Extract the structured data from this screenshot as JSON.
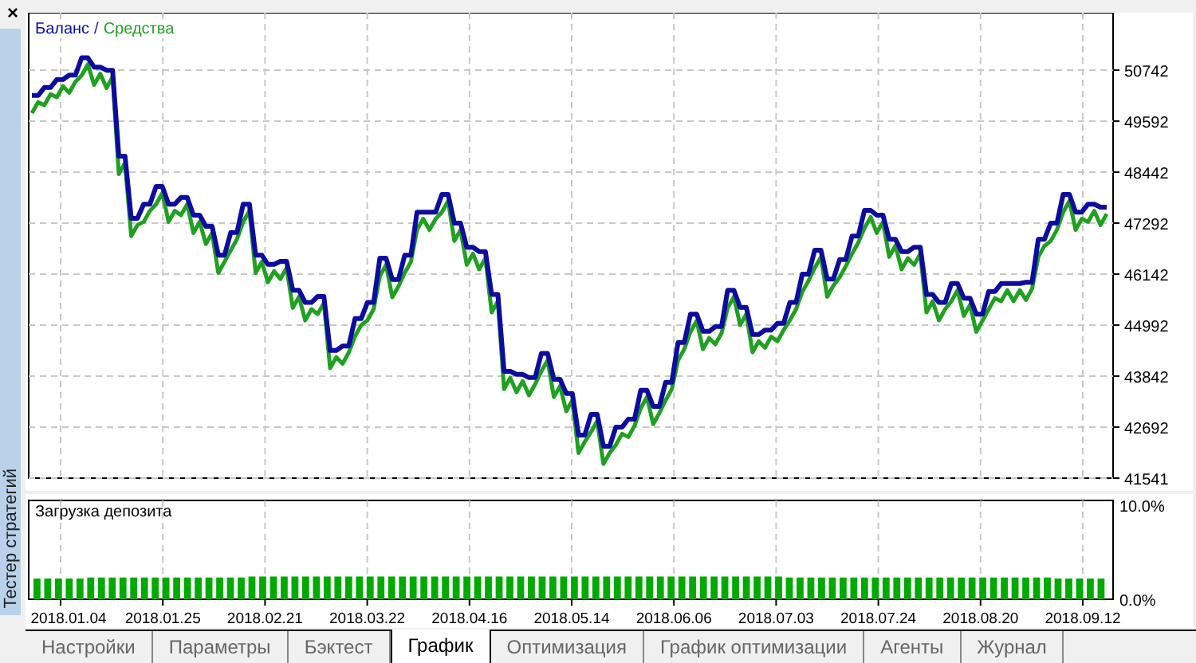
{
  "side_panel": {
    "close": "×",
    "title": "Тестер стратегий"
  },
  "balance_chart": {
    "legend_separator": "/",
    "chart_data": {
      "type": "line",
      "grid": true,
      "ylim": [
        41541,
        52036
      ],
      "categories": [
        null,
        null,
        null,
        null,
        null,
        null,
        null,
        null,
        null,
        null,
        null,
        null,
        null,
        null,
        null,
        null,
        null,
        null,
        null,
        null,
        null,
        null,
        null,
        null,
        null,
        null,
        null,
        null,
        null,
        null,
        null,
        null,
        null,
        null,
        null,
        null,
        null,
        null,
        null,
        null,
        null,
        null,
        null,
        null,
        null,
        null,
        null,
        null,
        null,
        null,
        null,
        null,
        null,
        null,
        null,
        null,
        null,
        null,
        null,
        null,
        null,
        null,
        null,
        null,
        null,
        null,
        null,
        null,
        null,
        null,
        null,
        null,
        null,
        null,
        null,
        null,
        null,
        null,
        null,
        null,
        null,
        null,
        null,
        null,
        null,
        null,
        null,
        null,
        null,
        null,
        null,
        null,
        null,
        null,
        null,
        null,
        null,
        null,
        null,
        null,
        null,
        null,
        null,
        null,
        null,
        null,
        null,
        null,
        null,
        null,
        null,
        null,
        null,
        null,
        null,
        null,
        null,
        null,
        null,
        null,
        null,
        null,
        null,
        null,
        null,
        null,
        null,
        null,
        null,
        null,
        null,
        null,
        null,
        null,
        null,
        null,
        null,
        null,
        null,
        null,
        null,
        null,
        null,
        null,
        null,
        null,
        null,
        null,
        null,
        null,
        null,
        null,
        null,
        null,
        null,
        null,
        null,
        null,
        null,
        null,
        null,
        null,
        null,
        null,
        null,
        null,
        null,
        null,
        null,
        null,
        null,
        null,
        null,
        null
      ],
      "series": [
        {
          "name": "Баланс",
          "color": "#0c0ca0",
          "values": [
            50170,
            50170,
            50350,
            50350,
            50530,
            50530,
            50630,
            50630,
            51020,
            51020,
            50810,
            50810,
            50740,
            50740,
            48800,
            48800,
            47400,
            47400,
            47720,
            47720,
            48120,
            48120,
            47720,
            47720,
            47870,
            47870,
            47470,
            47470,
            47220,
            47220,
            46570,
            46570,
            47080,
            47080,
            47720,
            47720,
            46570,
            46570,
            46360,
            46360,
            46430,
            46430,
            45780,
            45780,
            45500,
            45500,
            45640,
            45640,
            44420,
            44420,
            44520,
            44520,
            45140,
            45140,
            45500,
            45500,
            46500,
            46500,
            46020,
            46020,
            46570,
            46570,
            47540,
            47540,
            47540,
            47540,
            47940,
            47940,
            47290,
            47290,
            46750,
            46750,
            46650,
            46650,
            45680,
            45680,
            43950,
            43950,
            43880,
            43880,
            43810,
            43810,
            44350,
            44350,
            43770,
            43770,
            43450,
            43450,
            42510,
            42510,
            42980,
            42980,
            42260,
            42260,
            42690,
            42690,
            42870,
            42870,
            43520,
            43520,
            43160,
            43160,
            43700,
            43700,
            44600,
            44600,
            45240,
            45240,
            44850,
            44850,
            44960,
            44960,
            45780,
            45780,
            45390,
            45390,
            44780,
            44780,
            44880,
            44880,
            45030,
            45030,
            45500,
            45500,
            46140,
            46140,
            46680,
            46680,
            46030,
            46030,
            46470,
            46470,
            47000,
            47000,
            47580,
            47580,
            47470,
            47470,
            46930,
            46930,
            46650,
            46650,
            46750,
            46750,
            45680,
            45680,
            45500,
            45500,
            45930,
            45930,
            45600,
            45600,
            45240,
            45240,
            45750,
            45750,
            45930,
            45930,
            45930,
            45930,
            45960,
            45960,
            46930,
            46930,
            47290,
            47290,
            47940,
            47940,
            47540,
            47540,
            47720,
            47720,
            47650,
            47650
          ]
        },
        {
          "name": "Средства",
          "color": "#20a020",
          "values": [
            49770,
            50020,
            49950,
            50200,
            50130,
            50380,
            50230,
            50480,
            50620,
            50870,
            50410,
            50660,
            50340,
            50590,
            48400,
            48650,
            47000,
            47250,
            47320,
            47570,
            47720,
            47970,
            47320,
            47570,
            47470,
            47720,
            47070,
            47320,
            46820,
            47070,
            46170,
            46420,
            46680,
            46930,
            47320,
            47570,
            46170,
            46420,
            45960,
            46210,
            46030,
            46280,
            45380,
            45630,
            45100,
            45350,
            45240,
            45490,
            44020,
            44270,
            44120,
            44370,
            44740,
            44990,
            45100,
            45350,
            46100,
            46350,
            45620,
            45870,
            46170,
            46420,
            47140,
            47390,
            47140,
            47390,
            47540,
            47790,
            46890,
            47140,
            46350,
            46600,
            46250,
            46500,
            45280,
            45530,
            43550,
            43800,
            43480,
            43730,
            43410,
            43660,
            43950,
            44200,
            43370,
            43620,
            43050,
            43300,
            42110,
            42360,
            42580,
            42830,
            41860,
            42110,
            42290,
            42540,
            42470,
            42720,
            43120,
            43370,
            42760,
            43010,
            43300,
            43550,
            44200,
            44450,
            44840,
            45090,
            44450,
            44700,
            44560,
            44810,
            45380,
            45630,
            44990,
            45240,
            44380,
            44630,
            44480,
            44730,
            44630,
            44880,
            45100,
            45350,
            45740,
            45990,
            46280,
            46530,
            45630,
            45880,
            46070,
            46320,
            46600,
            46850,
            47180,
            47430,
            47070,
            47320,
            46530,
            46780,
            46250,
            46500,
            46350,
            46600,
            45280,
            45530,
            45100,
            45350,
            45530,
            45780,
            45200,
            45450,
            44840,
            45090,
            45350,
            45600,
            45530,
            45780,
            45530,
            45780,
            45560,
            45810,
            46530,
            46780,
            46890,
            47140,
            47540,
            47790,
            47140,
            47390,
            47320,
            47570,
            47250,
            47500
          ]
        }
      ],
      "yticks": [
        50742,
        49592,
        48442,
        47292,
        46142,
        44992,
        43842,
        42692,
        41541
      ]
    }
  },
  "deposit_chart": {
    "chart_data": {
      "type": "bar",
      "grid": true,
      "ylim": [
        0,
        10
      ],
      "categories": [
        null,
        null,
        null,
        null,
        null,
        null,
        null,
        null,
        null,
        null,
        null,
        null,
        null,
        null,
        null,
        null,
        null,
        null,
        null,
        null,
        null,
        null,
        null,
        null,
        null,
        null,
        null,
        null,
        null,
        null,
        null,
        null,
        null,
        null,
        null,
        null,
        null,
        null,
        null,
        null,
        null,
        null,
        null,
        null,
        null,
        null,
        null,
        null,
        null,
        null,
        null,
        null,
        null,
        null,
        null,
        null,
        null,
        null,
        null,
        null,
        null,
        null,
        null,
        null,
        null,
        null,
        null,
        null,
        null,
        null,
        null,
        null,
        null,
        null,
        null,
        null,
        null,
        null,
        null,
        null,
        null,
        null,
        null,
        null,
        null,
        null,
        null,
        null,
        null,
        null,
        null,
        null,
        null,
        null,
        null,
        null,
        null,
        null,
        null,
        null
      ],
      "series": [
        {
          "name": "Загрузка депозита",
          "color": "#00aa00",
          "values": [
            2.1,
            2.1,
            2.1,
            2.1,
            2.1,
            2.2,
            2.2,
            2.2,
            2.2,
            2.2,
            2.2,
            2.2,
            2.2,
            2.2,
            2.2,
            2.2,
            2.2,
            2.2,
            2.2,
            2.2,
            2.3,
            2.3,
            2.3,
            2.3,
            2.3,
            2.3,
            2.3,
            2.3,
            2.3,
            2.3,
            2.3,
            2.3,
            2.3,
            2.3,
            2.3,
            2.3,
            2.3,
            2.3,
            2.3,
            2.3,
            2.3,
            2.3,
            2.3,
            2.3,
            2.3,
            2.3,
            2.3,
            2.3,
            2.3,
            2.3,
            2.3,
            2.3,
            2.3,
            2.3,
            2.3,
            2.3,
            2.3,
            2.3,
            2.3,
            2.3,
            2.3,
            2.3,
            2.3,
            2.3,
            2.3,
            2.3,
            2.3,
            2.3,
            2.3,
            2.3,
            2.2,
            2.2,
            2.2,
            2.2,
            2.2,
            2.2,
            2.2,
            2.2,
            2.2,
            2.2,
            2.2,
            2.2,
            2.2,
            2.2,
            2.2,
            2.2,
            2.2,
            2.2,
            2.2,
            2.2,
            2.2,
            2.2,
            2.2,
            2.2,
            2.2,
            2.1,
            2.1,
            2.1,
            2.1,
            2.1
          ]
        }
      ],
      "yticks": [
        {
          "value": 10,
          "label": "10.0%"
        },
        {
          "value": 0,
          "label": "0.0%"
        }
      ]
    }
  },
  "date_axis": [
    "2018.01.04",
    "2018.01.25",
    "2018.02.21",
    "2018.03.22",
    "2018.04.16",
    "2018.05.14",
    "2018.06.06",
    "2018.07.03",
    "2018.07.24",
    "2018.08.20",
    "2018.09.12"
  ],
  "tabs": [
    {
      "label": "Настройки",
      "selected": false
    },
    {
      "label": "Параметры",
      "selected": false
    },
    {
      "label": "Бэктест",
      "selected": false
    },
    {
      "label": "График",
      "selected": true
    },
    {
      "label": "Оптимизация",
      "selected": false
    },
    {
      "label": "График оптимизации",
      "selected": false
    },
    {
      "label": "Агенты",
      "selected": false
    },
    {
      "label": "Журнал",
      "selected": false
    }
  ]
}
